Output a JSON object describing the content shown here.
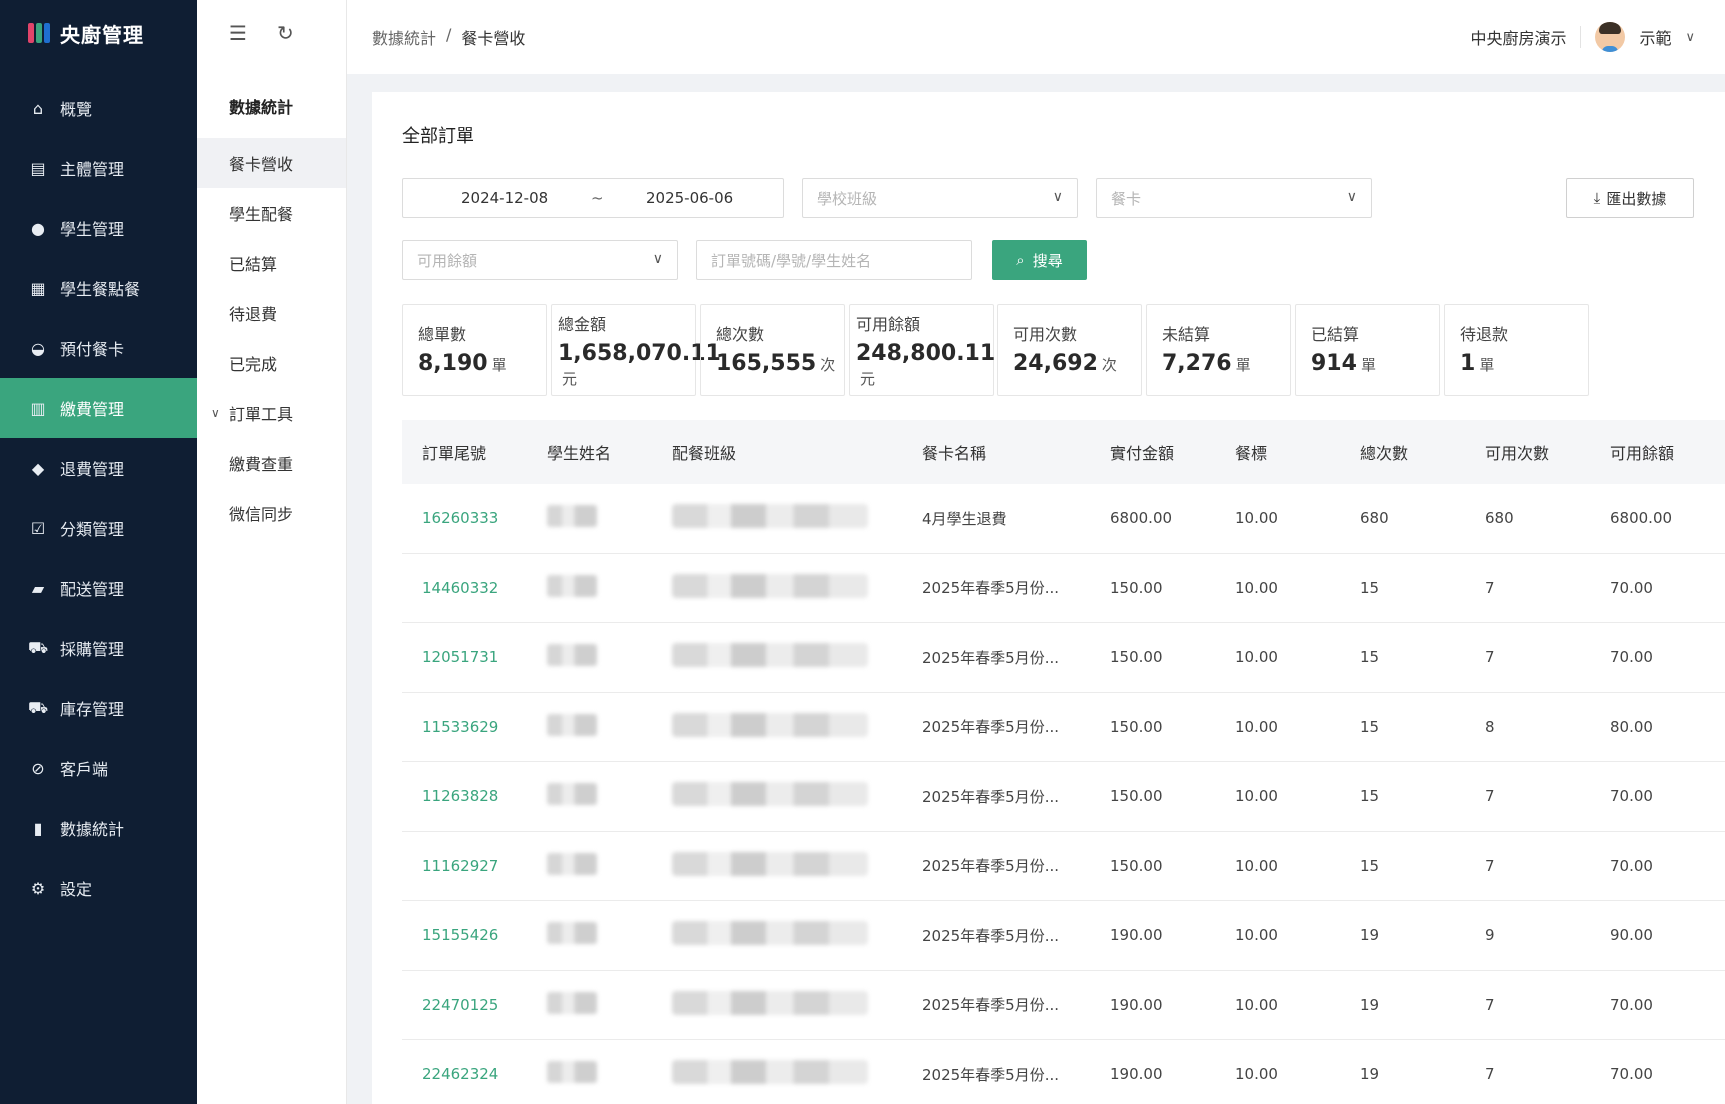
{
  "app": {
    "title": "央廚管理",
    "logo_colors": [
      "#e0446a",
      "#3aa57e",
      "#1f6fcf"
    ]
  },
  "sidebar": {
    "items": [
      {
        "label": "概覽",
        "icon": "home-icon",
        "glyph": "⌂",
        "active": false
      },
      {
        "label": "主體管理",
        "icon": "store-icon",
        "glyph": "▤",
        "active": false
      },
      {
        "label": "學生管理",
        "icon": "user-icon",
        "glyph": "●",
        "active": false
      },
      {
        "label": "學生餐點餐",
        "icon": "document-icon",
        "glyph": "▦",
        "active": false
      },
      {
        "label": "預付餐卡",
        "icon": "basket-icon",
        "glyph": "◒",
        "active": false
      },
      {
        "label": "繳費管理",
        "icon": "clipboard-icon",
        "glyph": "▥",
        "active": true
      },
      {
        "label": "退費管理",
        "icon": "tags-icon",
        "glyph": "◆",
        "active": false
      },
      {
        "label": "分類管理",
        "icon": "check-square-icon",
        "glyph": "☑",
        "active": false
      },
      {
        "label": "配送管理",
        "icon": "truck-icon",
        "glyph": "▰",
        "active": false
      },
      {
        "label": "採購管理",
        "icon": "cart-icon",
        "glyph": "⛟",
        "active": false
      },
      {
        "label": "庫存管理",
        "icon": "warehouse-icon",
        "glyph": "⛟",
        "active": false
      },
      {
        "label": "客戶端",
        "icon": "link-icon",
        "glyph": "⊘",
        "active": false
      },
      {
        "label": "數據統計",
        "icon": "bar-chart-icon",
        "glyph": "▮",
        "active": false
      },
      {
        "label": "設定",
        "icon": "gear-icon",
        "glyph": "⚙",
        "active": false
      }
    ]
  },
  "submenu": {
    "title": "數據統計",
    "items": [
      {
        "label": "餐卡營收",
        "active": true,
        "expandable": false
      },
      {
        "label": "學生配餐",
        "active": false,
        "expandable": false
      },
      {
        "label": "已結算",
        "active": false,
        "expandable": false
      },
      {
        "label": "待退費",
        "active": false,
        "expandable": false
      },
      {
        "label": "已完成",
        "active": false,
        "expandable": false
      },
      {
        "label": "訂單工具",
        "active": false,
        "expandable": true
      },
      {
        "label": "繳費查重",
        "active": false,
        "expandable": false
      },
      {
        "label": "微信同步",
        "active": false,
        "expandable": false
      }
    ]
  },
  "header": {
    "breadcrumb": [
      "數據統計",
      "/",
      "餐卡營收"
    ],
    "org": "中央廚房演示",
    "user": "示範"
  },
  "filters": {
    "section_title": "全部訂單",
    "date_start": "2024-12-08",
    "date_sep": "~",
    "date_end": "2025-06-06",
    "class_placeholder": "學校班級",
    "card_placeholder": "餐卡",
    "balance_placeholder": "可用餘額",
    "search_placeholder": "訂單號碼/學號/學生姓名",
    "search_label": "搜尋",
    "export_label": "匯出數據"
  },
  "stats": [
    {
      "label": "總單數",
      "value": "8,190",
      "unit": "單"
    },
    {
      "label": "總金額",
      "value": "1,658,070.11",
      "unit": "元"
    },
    {
      "label": "總次數",
      "value": "165,555",
      "unit": "次"
    },
    {
      "label": "可用餘額",
      "value": "248,800.11",
      "unit": "元"
    },
    {
      "label": "可用次數",
      "value": "24,692",
      "unit": "次"
    },
    {
      "label": "未結算",
      "value": "7,276",
      "unit": "單"
    },
    {
      "label": "已結算",
      "value": "914",
      "unit": "單"
    },
    {
      "label": "待退款",
      "value": "1",
      "unit": "單"
    }
  ],
  "table": {
    "headers": [
      "訂單尾號",
      "學生姓名",
      "配餐班級",
      "餐卡名稱",
      "實付金額",
      "餐標",
      "總次數",
      "可用次數",
      "可用餘額"
    ],
    "rows": [
      [
        "16260333",
        "4月學生退費",
        "6800.00",
        "10.00",
        "680",
        "680",
        "6800.00"
      ],
      [
        "14460332",
        "2025年春季5月份...",
        "150.00",
        "10.00",
        "15",
        "7",
        "70.00"
      ],
      [
        "12051731",
        "2025年春季5月份...",
        "150.00",
        "10.00",
        "15",
        "7",
        "70.00"
      ],
      [
        "11533629",
        "2025年春季5月份...",
        "150.00",
        "10.00",
        "15",
        "8",
        "80.00"
      ],
      [
        "11263828",
        "2025年春季5月份...",
        "150.00",
        "10.00",
        "15",
        "7",
        "70.00"
      ],
      [
        "11162927",
        "2025年春季5月份...",
        "150.00",
        "10.00",
        "15",
        "7",
        "70.00"
      ],
      [
        "15155426",
        "2025年春季5月份...",
        "190.00",
        "10.00",
        "19",
        "9",
        "90.00"
      ],
      [
        "22470125",
        "2025年春季5月份...",
        "190.00",
        "10.00",
        "19",
        "7",
        "70.00"
      ],
      [
        "22462324",
        "2025年春季5月份...",
        "190.00",
        "10.00",
        "19",
        "7",
        "70.00"
      ]
    ]
  }
}
